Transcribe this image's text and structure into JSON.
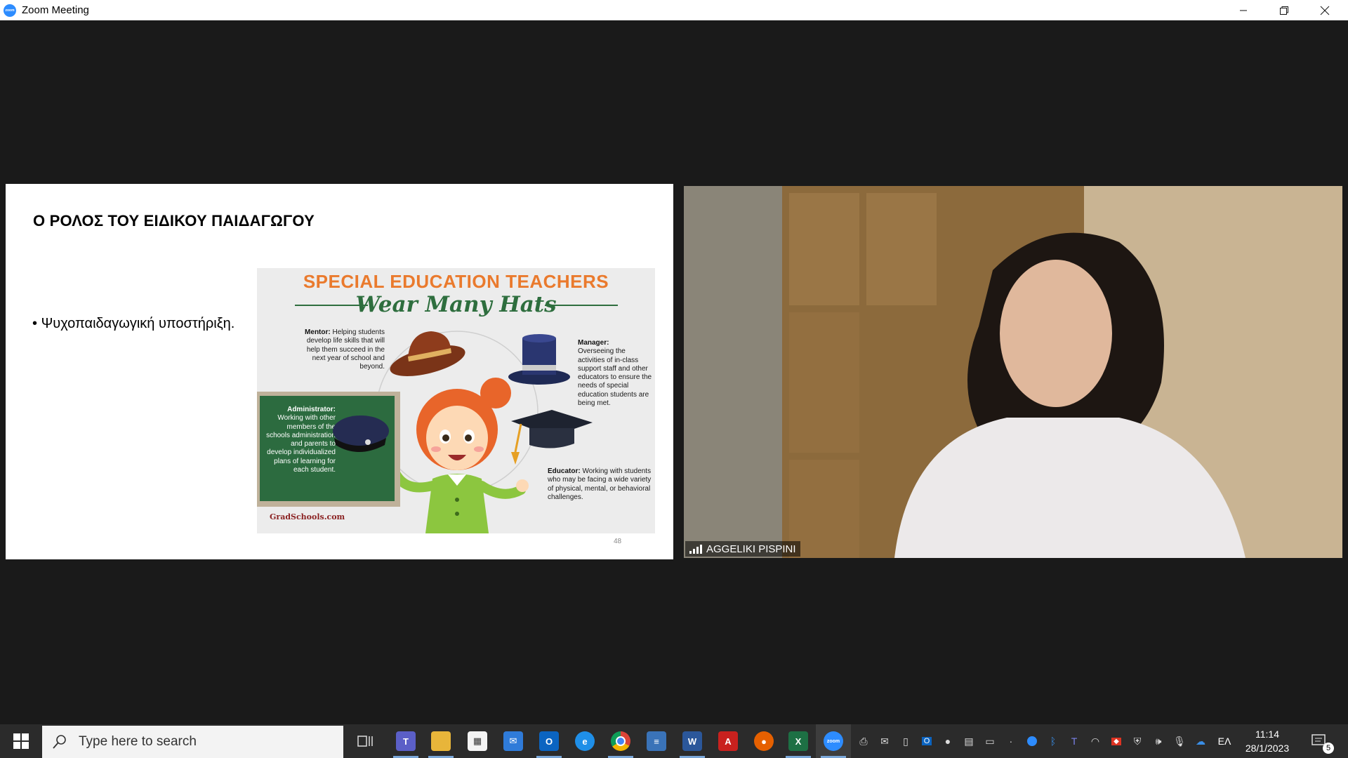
{
  "window": {
    "title": "Zoom Meeting"
  },
  "slide": {
    "title": "Ο ΡΟΛΟΣ ΤΟΥ ΕΙΔΙΚΟΥ ΠΑΙΔΑΓΩΓΟΥ",
    "bullet": "Ψυχοπαιδαγωγική υποστήριξη.",
    "page_number": "48",
    "infographic": {
      "title_line1": "SPECIAL EDUCATION TEACHERS",
      "title_line2": "Wear Many Hats",
      "mentor_label": "Mentor:",
      "mentor_text": "Helping students develop life skills that will help them succeed in the next year of school and beyond.",
      "manager_label": "Manager:",
      "manager_text": "Overseeing the activities of in-class support staff and other educators to ensure the needs of special education students are being met.",
      "administrator_label": "Administrator:",
      "administrator_text": "Working with other members of the schools administration and parents to develop individualized plans of learning for each student.",
      "educator_label": "Educator:",
      "educator_text": "Working with students who may be facing a wide variety of physical, mental, or behavioral challenges.",
      "logo": "GradSchools.com"
    }
  },
  "video": {
    "participant_name": "AGGELIKI PISPINI"
  },
  "taskbar": {
    "search_placeholder": "Type here to search",
    "language": "ΕΛ",
    "time": "11:14",
    "date": "28/1/2023",
    "notification_count": "5"
  }
}
